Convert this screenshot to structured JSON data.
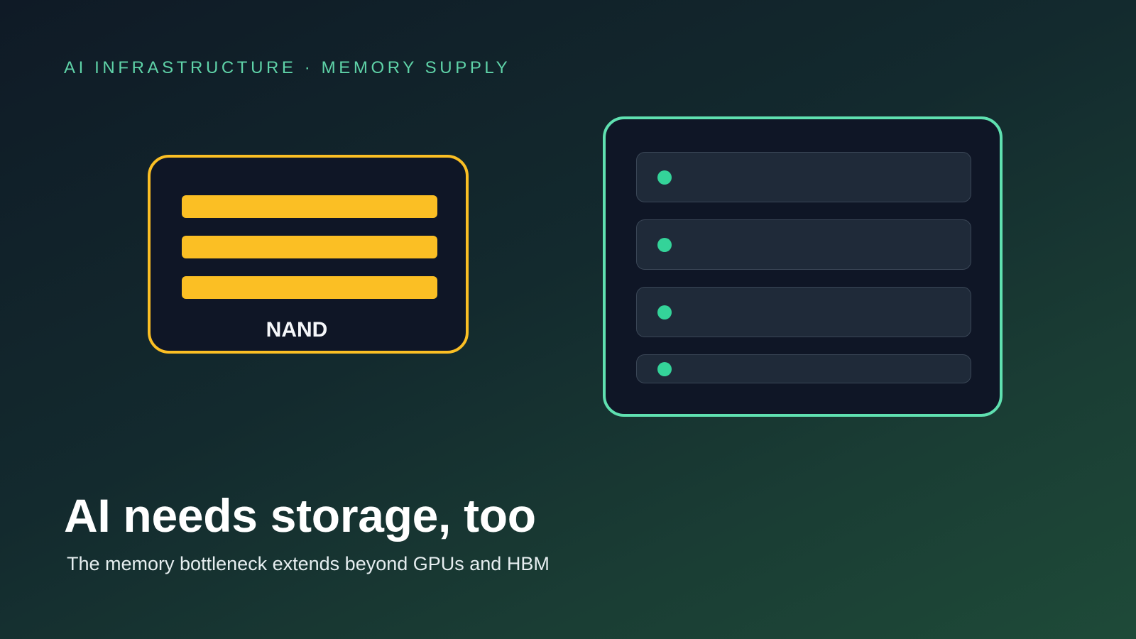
{
  "header": {
    "eyebrow": "AI INFRASTRUCTURE · MEMORY SUPPLY"
  },
  "illustration": {
    "nand_chip": {
      "label": "NAND",
      "bar_count": 3,
      "accent_color": "#fbbf24"
    },
    "storage_rack": {
      "slot_count": 4,
      "accent_color": "#5fe0b0",
      "indicator_color": "#34d399"
    }
  },
  "main": {
    "title": "AI needs storage, too",
    "subtitle": "The memory bottleneck extends beyond GPUs and HBM"
  }
}
